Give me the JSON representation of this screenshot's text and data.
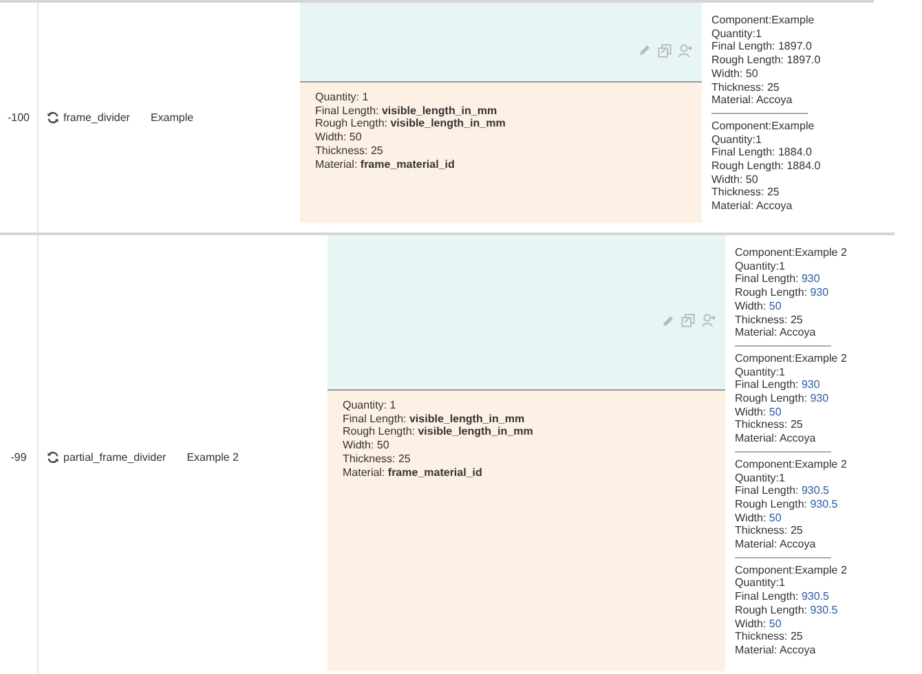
{
  "rows": [
    {
      "index": "-100",
      "name": "frame_divider",
      "label": "Example",
      "details": [
        "Quantity: 1",
        "Final Length: **visible_length_in_mm**",
        "Rough Length: **visible_length_in_mm**",
        "Width: 50",
        "Thickness: 25",
        "Material: **frame_material_id**"
      ],
      "components": [
        [
          {
            "label": "Component:",
            "value": "Example",
            "highlighted": false
          },
          {
            "label": "Quantity:",
            "value": "1",
            "highlighted": false
          },
          {
            "label": "Final Length: ",
            "value": "1897.0",
            "highlighted": false
          },
          {
            "label": "Rough Length: ",
            "value": "1897.0",
            "highlighted": false
          },
          {
            "label": "Width: ",
            "value": "50",
            "highlighted": false
          },
          {
            "label": "Thickness: ",
            "value": "25",
            "highlighted": false
          },
          {
            "label": "Material: ",
            "value": "Accoya",
            "highlighted": false
          }
        ],
        [
          {
            "label": "Component:",
            "value": "Example",
            "highlighted": false
          },
          {
            "label": "Quantity:",
            "value": "1",
            "highlighted": false
          },
          {
            "label": "Final Length: ",
            "value": "1884.0",
            "highlighted": false
          },
          {
            "label": "Rough Length: ",
            "value": "1884.0",
            "highlighted": false
          },
          {
            "label": "Width: ",
            "value": "50",
            "highlighted": false
          },
          {
            "label": "Thickness: ",
            "value": "25",
            "highlighted": false
          },
          {
            "label": "Material: ",
            "value": "Accoya",
            "highlighted": false
          }
        ]
      ]
    },
    {
      "index": "-99",
      "name": "partial_frame_divider",
      "label": "Example 2",
      "details": [
        "Quantity: 1",
        "Final Length: **visible_length_in_mm**",
        "Rough Length: **visible_length_in_mm**",
        "Width: 50",
        "Thickness: 25",
        "Material: **frame_material_id**"
      ],
      "components": [
        [
          {
            "label": "Component:",
            "value": "Example 2",
            "highlighted": false
          },
          {
            "label": "Quantity:",
            "value": "1",
            "highlighted": false
          },
          {
            "label": "Final Length: ",
            "value": "930",
            "highlighted": true
          },
          {
            "label": "Rough Length: ",
            "value": "930",
            "highlighted": true
          },
          {
            "label": "Width: ",
            "value": "50",
            "highlighted": true
          },
          {
            "label": "Thickness: ",
            "value": "25",
            "highlighted": false
          },
          {
            "label": "Material: ",
            "value": "Accoya",
            "highlighted": false
          }
        ],
        [
          {
            "label": "Component:",
            "value": "Example 2",
            "highlighted": false
          },
          {
            "label": "Quantity:",
            "value": "1",
            "highlighted": false
          },
          {
            "label": "Final Length: ",
            "value": "930",
            "highlighted": true
          },
          {
            "label": "Rough Length: ",
            "value": "930",
            "highlighted": true
          },
          {
            "label": "Width: ",
            "value": "50",
            "highlighted": true
          },
          {
            "label": "Thickness: ",
            "value": "25",
            "highlighted": false
          },
          {
            "label": "Material: ",
            "value": "Accoya",
            "highlighted": false
          }
        ],
        [
          {
            "label": "Component:",
            "value": "Example 2",
            "highlighted": false
          },
          {
            "label": "Quantity:",
            "value": "1",
            "highlighted": false
          },
          {
            "label": "Final Length: ",
            "value": "930.5",
            "highlighted": true
          },
          {
            "label": "Rough Length: ",
            "value": "930.5",
            "highlighted": true
          },
          {
            "label": "Width: ",
            "value": "50",
            "highlighted": true
          },
          {
            "label": "Thickness: ",
            "value": "25",
            "highlighted": false
          },
          {
            "label": "Material: ",
            "value": "Accoya",
            "highlighted": false
          }
        ],
        [
          {
            "label": "Component:",
            "value": "Example 2",
            "highlighted": false
          },
          {
            "label": "Quantity:",
            "value": "1",
            "highlighted": false
          },
          {
            "label": "Final Length: ",
            "value": "930.5",
            "highlighted": true
          },
          {
            "label": "Rough Length: ",
            "value": "930.5",
            "highlighted": true
          },
          {
            "label": "Width: ",
            "value": "50",
            "highlighted": true
          },
          {
            "label": "Thickness: ",
            "value": "25",
            "highlighted": false
          },
          {
            "label": "Material: ",
            "value": "Accoya",
            "highlighted": false
          }
        ]
      ]
    }
  ]
}
